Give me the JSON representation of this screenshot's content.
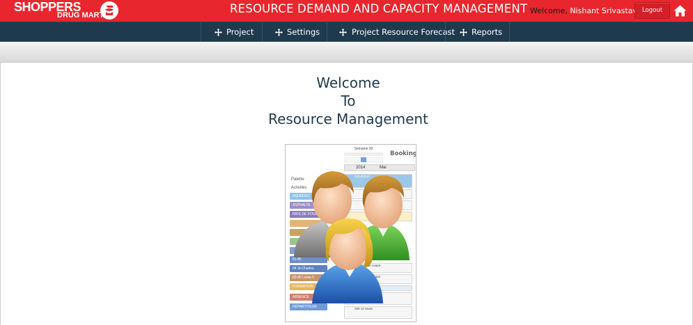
{
  "header": {
    "logo": {
      "line1": "SHOPPERS",
      "line2": "DRUG MART"
    },
    "title": "RESOURCE DEMAND AND CAPACITY MANAGEMENT",
    "welcome_label": "Welcome,",
    "user_name": "Nishant Srivastava",
    "logout_label": "Logout",
    "home_icon": "home-icon"
  },
  "colors": {
    "header_red": "#e8262d",
    "navbar_navy": "#1f3a4d",
    "heading_navy": "#1f3a4d"
  },
  "nav": {
    "items": [
      {
        "label": "Project",
        "icon": "move-icon"
      },
      {
        "label": "Settings",
        "icon": "move-icon"
      },
      {
        "label": "Project Resource Forecast",
        "icon": "move-icon"
      },
      {
        "label": "Reports",
        "icon": "move-icon"
      }
    ]
  },
  "main": {
    "heading_line1": "Welcome",
    "heading_line2": "To",
    "heading_line3": "Resource Management"
  },
  "illustration": {
    "week_label": "Semaine 20",
    "booking_label": "Booking",
    "year": "2014",
    "month": "Mai",
    "palette_label": "Palette",
    "activities_label": "Activités",
    "palette_items": [
      "AQUEDUC",
      "ASPHALTE",
      "NIDS DE POULE",
      "",
      "",
      "",
      "",
      "81-85",
      "84 St-Charles",
      "83-85 Louis-C",
      "FORMATION",
      "ABSENCE",
      "RÉPARTITEUR"
    ],
    "booking_items": [
      "AQUEDUC",
      "Créateur de coupe",
      "Créateur de coupe",
      "Équipements",
      "Rétrocaveuse",
      "260 12 roues"
    ]
  }
}
